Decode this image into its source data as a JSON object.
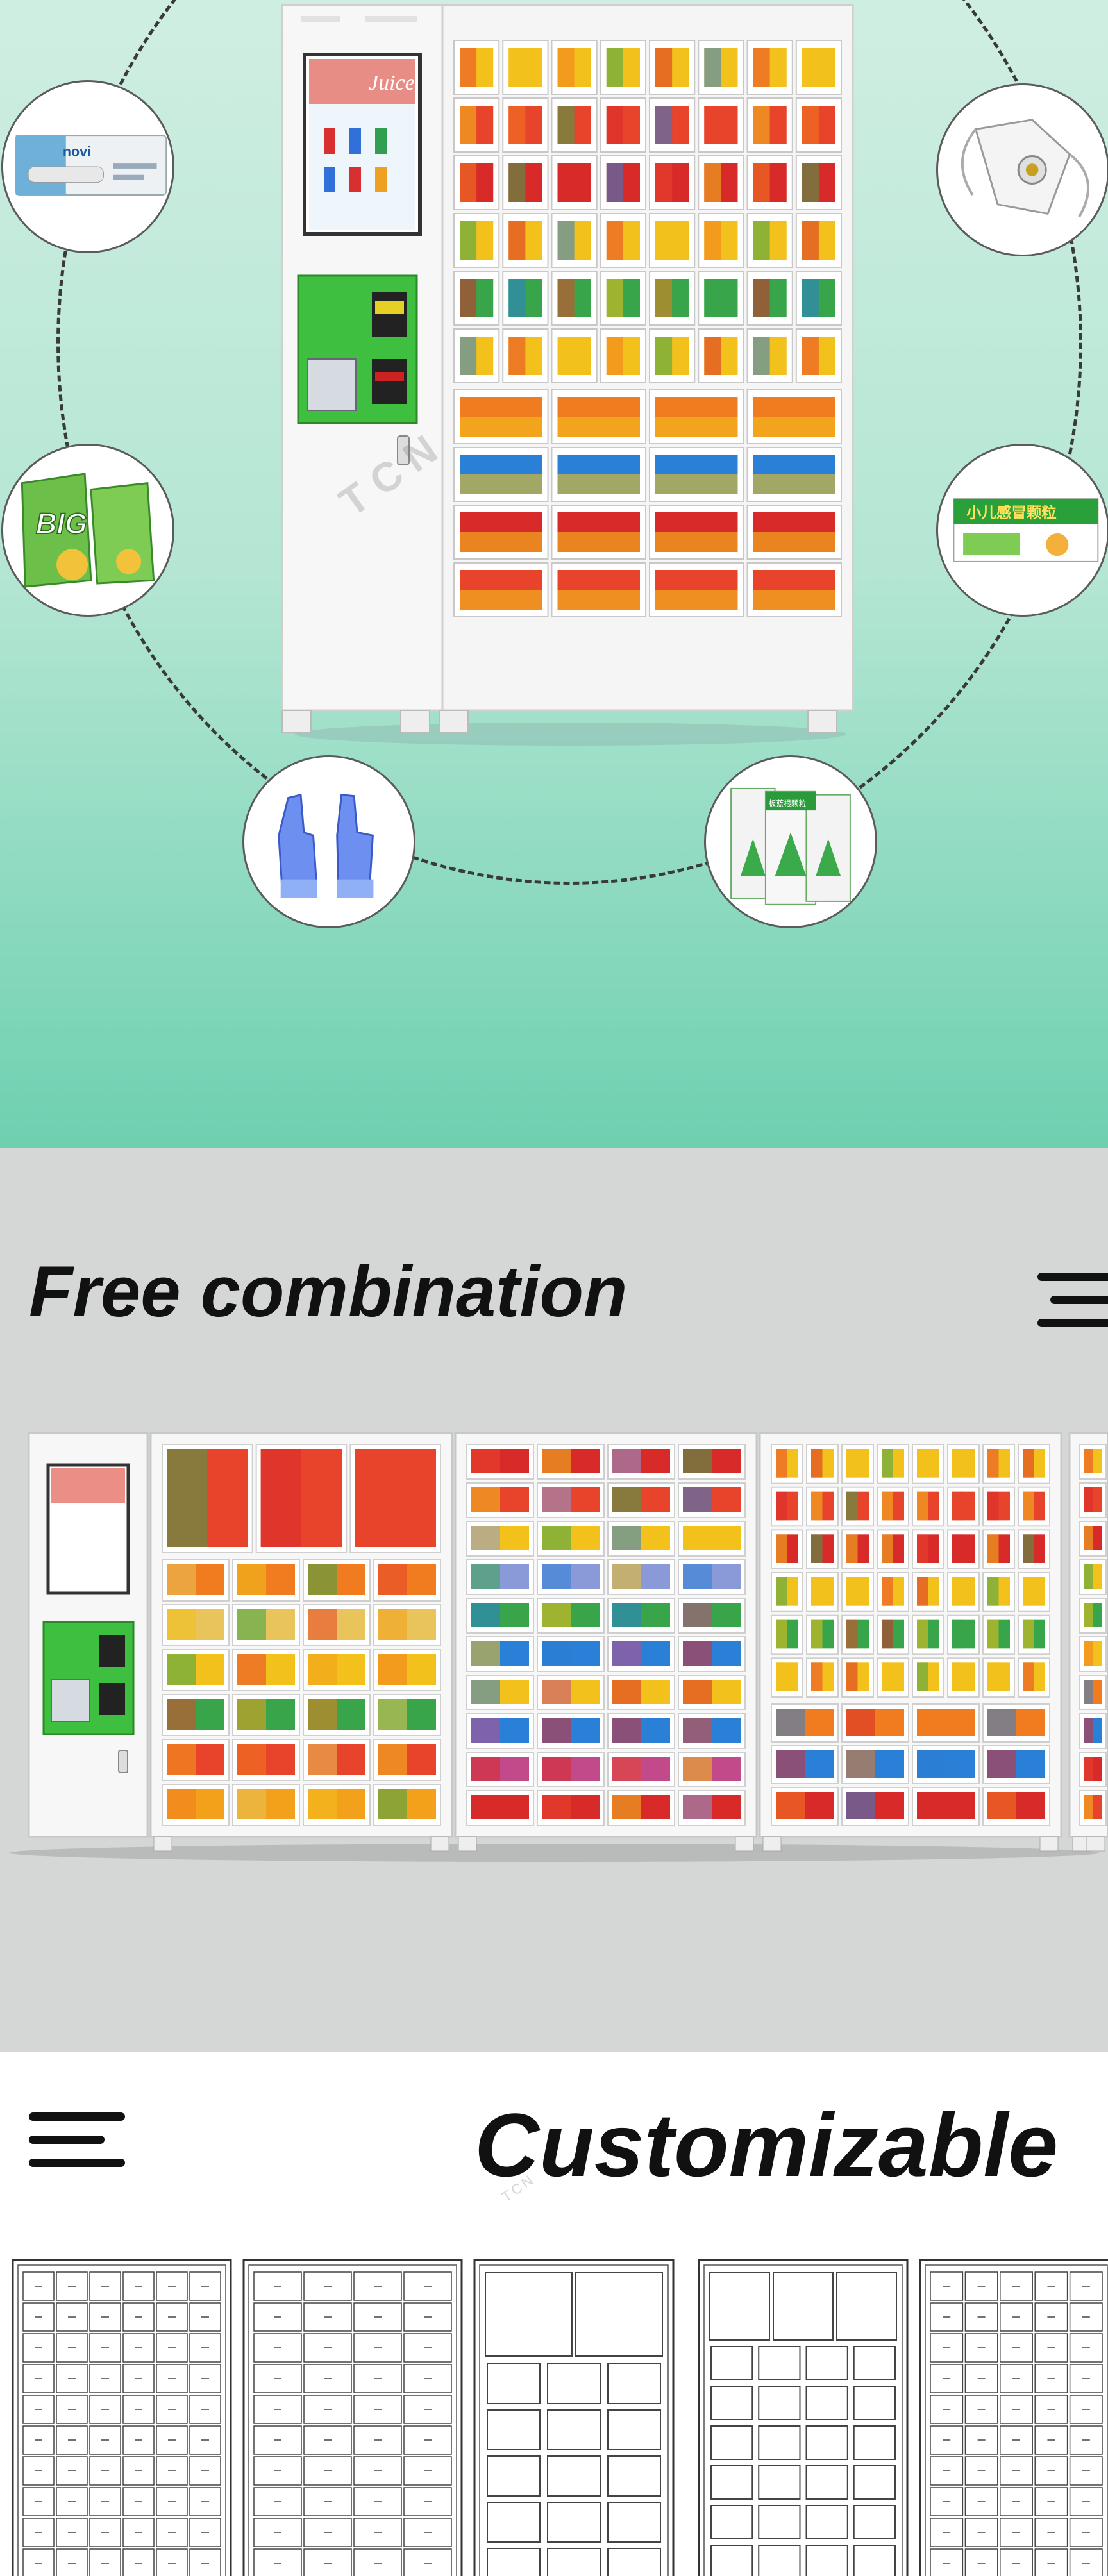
{
  "hero": {
    "machine": {
      "screen_brand": "Juice",
      "grid_cols": 8,
      "grid_rows_small": 6,
      "grid_rows_large": 4,
      "product_colors": [
        "#e8432b",
        "#f3c11b",
        "#f07c1f",
        "#38a54a",
        "#d92a2a",
        "#2a7fd6"
      ]
    },
    "circle_products": [
      {
        "name": "thermometer",
        "label": "novi"
      },
      {
        "name": "mask"
      },
      {
        "name": "chips",
        "label": "BIG"
      },
      {
        "name": "medicine-box",
        "label": "小儿感冒颗粒"
      },
      {
        "name": "gloves"
      },
      {
        "name": "tea-pouches",
        "label": "板蓝根颗粒"
      }
    ],
    "watermark": "TCN"
  },
  "combination": {
    "title": "Free combination",
    "cabinets": [
      "main-with-screen",
      "large-snack",
      "small-drinks",
      "mixed-grid",
      "partial"
    ]
  },
  "customizable": {
    "title": "Customizable"
  },
  "colors": {
    "accent_green": "#3fbf3f",
    "hero_top": "#cfeee2",
    "hero_bottom": "#6ed0b0",
    "combo_bg": "#d5d7d6"
  }
}
